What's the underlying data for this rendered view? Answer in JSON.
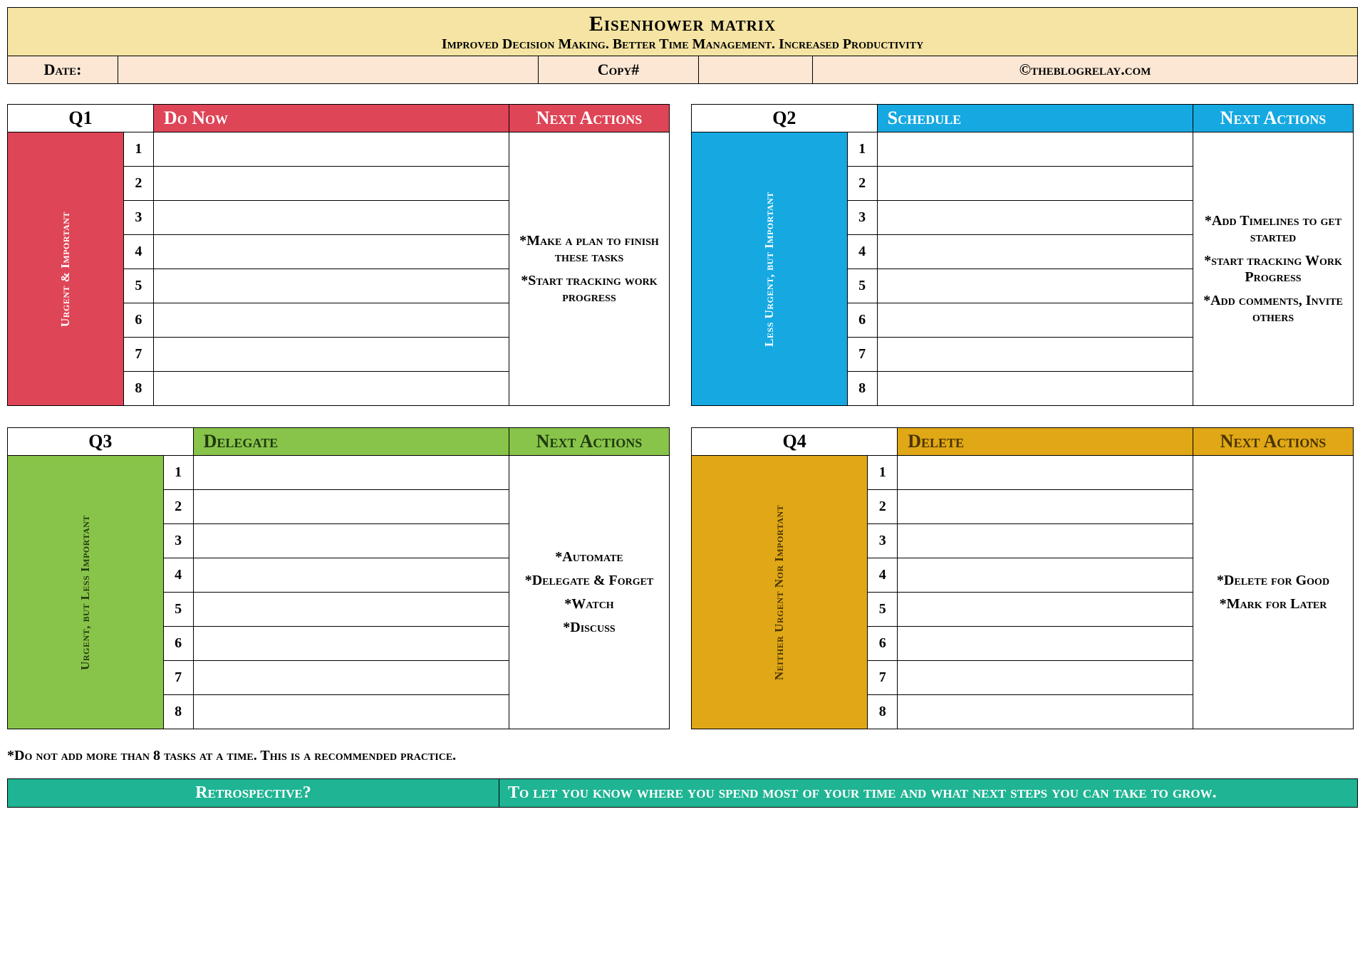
{
  "header": {
    "title": "Eisenhower matrix",
    "subtitle": "Improved Decision Making. Better Time Management. Increased Productivity"
  },
  "meta": {
    "date_label": "Date:",
    "date_value": "",
    "copy_label": "Copy#",
    "copy_value": "",
    "copyright": "©theblogrelay.com"
  },
  "quadrants": [
    {
      "code": "Q1",
      "title": "Do Now",
      "side_label": "Urgent & Important",
      "next_header": "Next Actions",
      "rows": [
        "1",
        "2",
        "3",
        "4",
        "5",
        "6",
        "7",
        "8"
      ],
      "tasks": [
        "",
        "",
        "",
        "",
        "",
        "",
        "",
        ""
      ],
      "next_actions": [
        "*Make a plan to finish these tasks",
        "*Start tracking work progress"
      ]
    },
    {
      "code": "Q2",
      "title": "Schedule",
      "side_label": "Less Urgent, but Important",
      "next_header": "Next Actions",
      "rows": [
        "1",
        "2",
        "3",
        "4",
        "5",
        "6",
        "7",
        "8"
      ],
      "tasks": [
        "",
        "",
        "",
        "",
        "",
        "",
        "",
        ""
      ],
      "next_actions": [
        "*Add Timelines to get started",
        "*start tracking Work Progress",
        "*Add comments, Invite others"
      ]
    },
    {
      "code": "Q3",
      "title": "Delegate",
      "side_label": "Urgent, but Less Important",
      "next_header": "Next Actions",
      "rows": [
        "1",
        "2",
        "3",
        "4",
        "5",
        "6",
        "7",
        "8"
      ],
      "tasks": [
        "",
        "",
        "",
        "",
        "",
        "",
        "",
        ""
      ],
      "next_actions": [
        "*Automate",
        "*Delegate & Forget",
        "*Watch",
        "*Discuss"
      ]
    },
    {
      "code": "Q4",
      "title": "Delete",
      "side_label": "Neither Urgent Nor Important",
      "next_header": "Next Actions",
      "rows": [
        "1",
        "2",
        "3",
        "4",
        "5",
        "6",
        "7",
        "8"
      ],
      "tasks": [
        "",
        "",
        "",
        "",
        "",
        "",
        "",
        ""
      ],
      "next_actions": [
        "*Delete for Good",
        "*Mark for Later"
      ]
    }
  ],
  "footnote": "*Do not add more than 8 tasks at a time. This is a recommended practice.",
  "retro": {
    "label": "Retrospective?",
    "text": "To let you know where you spend most of your time and what next steps you can take to grow."
  }
}
